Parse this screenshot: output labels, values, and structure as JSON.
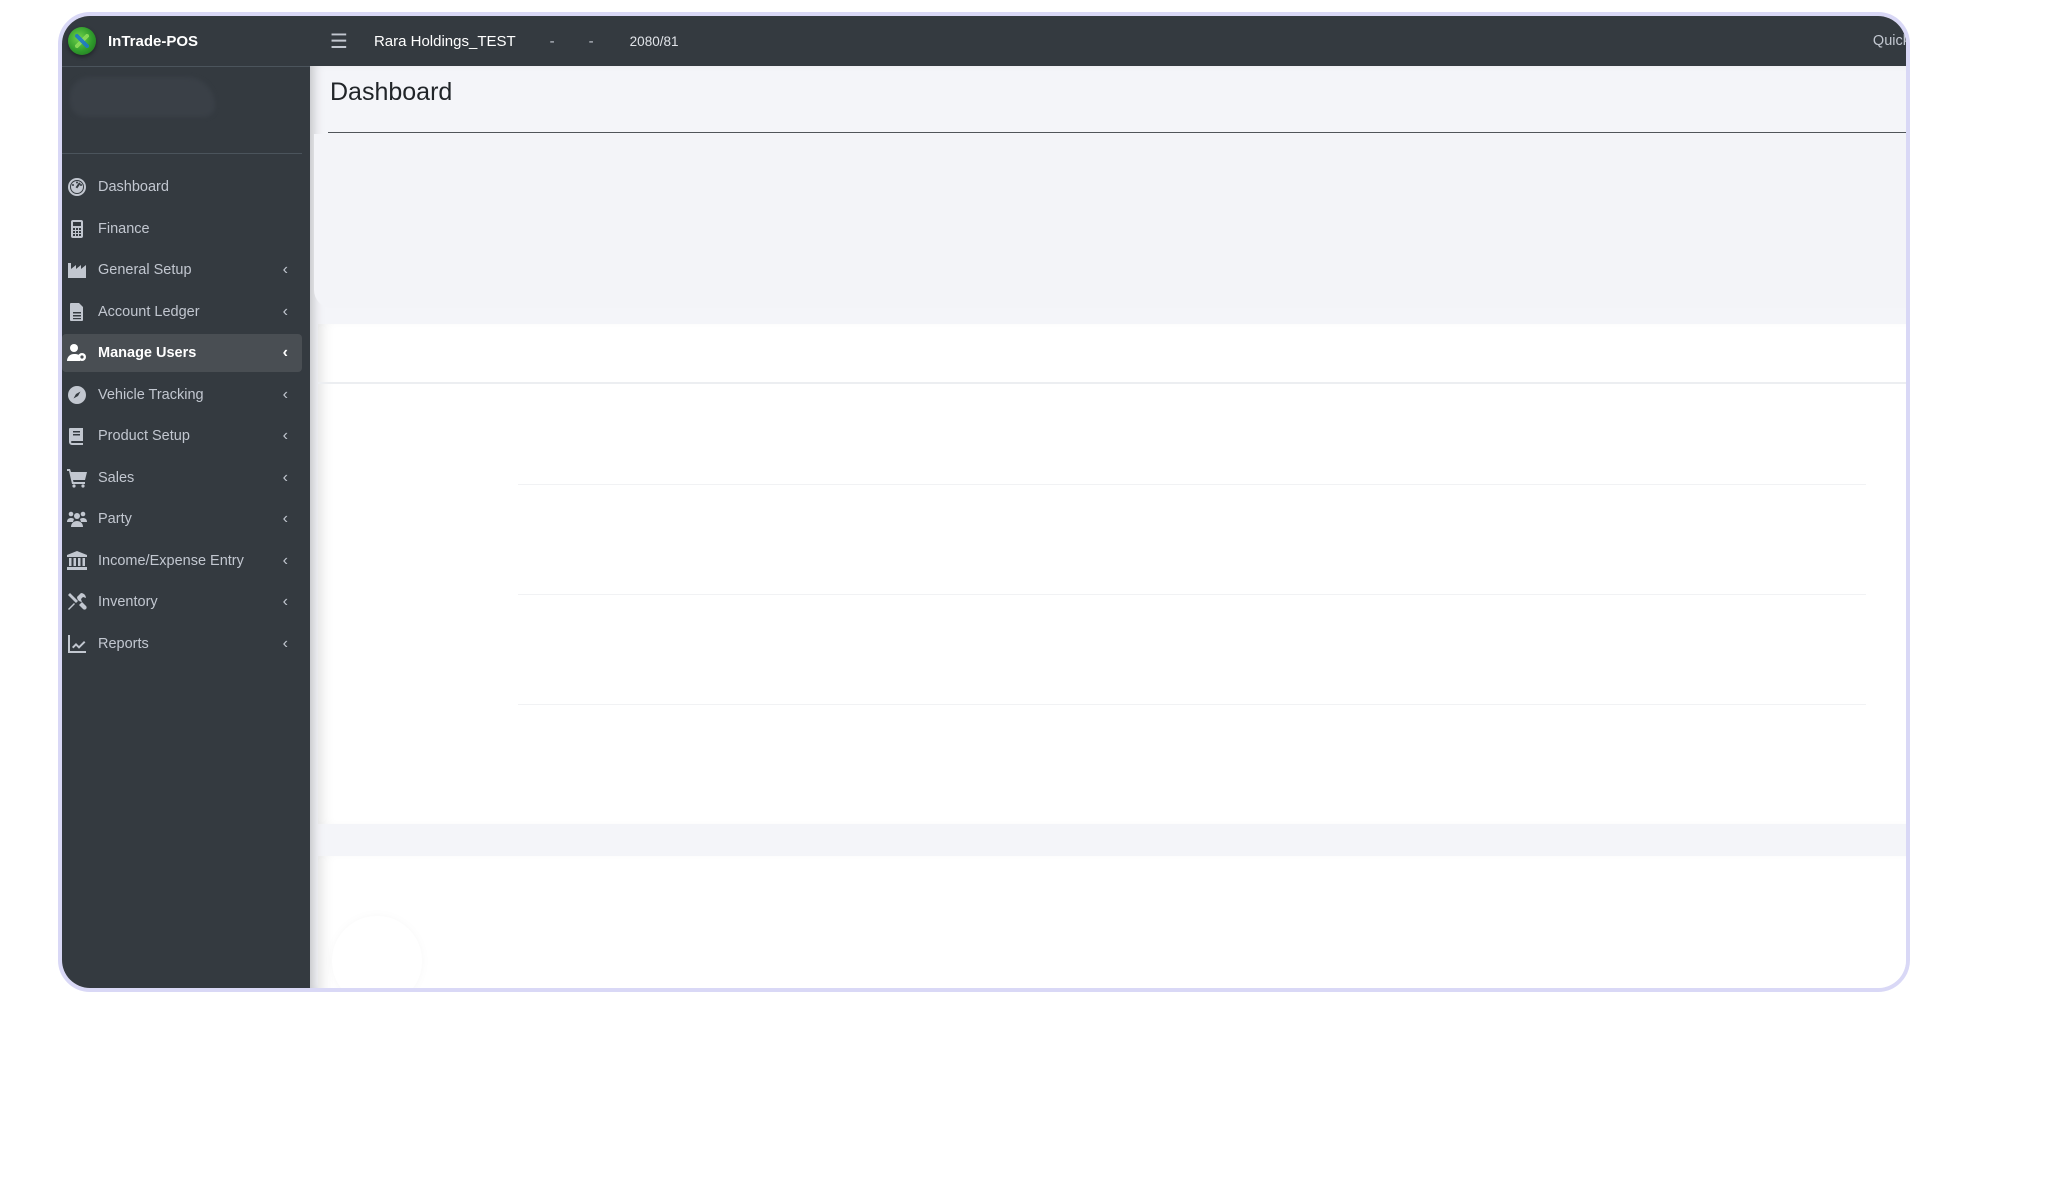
{
  "app": {
    "brand": "InTrade-POS",
    "brand_color": "#2f9b2c",
    "sidebar_bg": "#343a40"
  },
  "topbar": {
    "menu_icon": "hamburger-icon",
    "company": "Rara Holdings_TEST",
    "separator_1": "-",
    "separator_2": "-",
    "fiscal_year": "2080/81",
    "quick_link": "Quick"
  },
  "sidebar": {
    "items": [
      {
        "label": "Dashboard",
        "icon": "tachometer-icon",
        "has_children": false,
        "active": false
      },
      {
        "label": "Finance",
        "icon": "calculator-icon",
        "has_children": false,
        "active": false
      },
      {
        "label": "General Setup",
        "icon": "industry-icon",
        "has_children": true,
        "active": false
      },
      {
        "label": "Account Ledger",
        "icon": "file-alt-icon",
        "has_children": true,
        "active": false
      },
      {
        "label": "Manage Users",
        "icon": "users-cog-icon",
        "has_children": true,
        "active": true
      },
      {
        "label": "Vehicle Tracking",
        "icon": "compass-icon",
        "has_children": true,
        "active": false
      },
      {
        "label": "Product Setup",
        "icon": "book-icon",
        "has_children": true,
        "active": false
      },
      {
        "label": "Sales",
        "icon": "shopping-cart-icon",
        "has_children": true,
        "active": false
      },
      {
        "label": "Party",
        "icon": "users-icon",
        "has_children": true,
        "active": false
      },
      {
        "label": "Income/Expense Entry",
        "icon": "university-icon",
        "has_children": true,
        "active": false
      },
      {
        "label": "Inventory",
        "icon": "tools-icon",
        "has_children": true,
        "active": false
      },
      {
        "label": "Reports",
        "icon": "chart-line-icon",
        "has_children": true,
        "active": false
      }
    ],
    "chevron": "‹"
  },
  "main": {
    "page_title": "Dashboard"
  }
}
